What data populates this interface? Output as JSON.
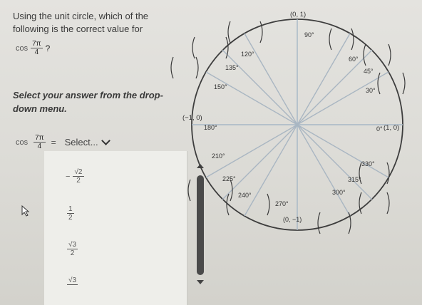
{
  "question": {
    "text": "Using the unit circle, which of the following is the correct value for",
    "cos_label": "cos",
    "frac_num": "7π",
    "frac_den": "4",
    "qmark": "?"
  },
  "instruction": "Select your answer from the drop-down menu.",
  "answer": {
    "cos_label": "cos",
    "frac_num": "7π",
    "frac_den": "4",
    "equals": "=",
    "select_label": "Select..."
  },
  "options": [
    {
      "sign": "−",
      "num": "√2",
      "den": "2"
    },
    {
      "sign": "",
      "num": "1",
      "den": "2"
    },
    {
      "sign": "",
      "num": "√3",
      "den": "2"
    },
    {
      "sign": "",
      "num": "√3",
      "den": ""
    }
  ],
  "unit_circle": {
    "degrees": [
      "90°",
      "60°",
      "45°",
      "30°",
      "0°",
      "330°",
      "315°",
      "300°",
      "270°",
      "240°",
      "225°",
      "210°",
      "180°",
      "150°",
      "135°",
      "120°"
    ],
    "points": {
      "top": "(0, 1)",
      "right": "(1, 0)",
      "left": "(−1, 0)",
      "bottom": "(0, −1)"
    }
  }
}
